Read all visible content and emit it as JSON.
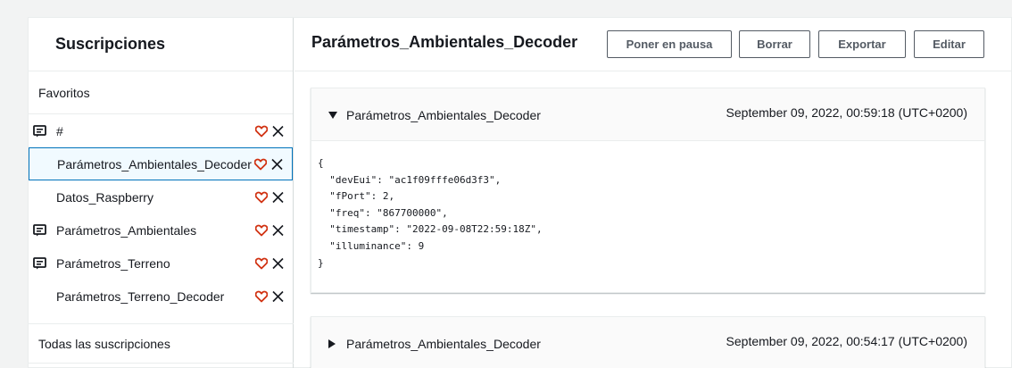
{
  "left_panel": {
    "title": "Suscripciones",
    "favorites_label": "Favoritos",
    "all_label": "Todas las suscripciones",
    "topics": [
      {
        "label": "#",
        "icon": "message-icon",
        "selected": false
      },
      {
        "label": "Parámetros_Ambientales_Decoder",
        "icon": null,
        "selected": true
      },
      {
        "label": "Datos_Raspberry",
        "icon": null,
        "selected": false
      },
      {
        "label": "Parámetros_Ambientales",
        "icon": "message-icon",
        "selected": false
      },
      {
        "label": "Parámetros_Terreno",
        "icon": "message-icon",
        "selected": false
      },
      {
        "label": "Parámetros_Terreno_Decoder",
        "icon": null,
        "selected": false
      }
    ]
  },
  "right_panel": {
    "title": "Parámetros_Ambientales_Decoder",
    "buttons": {
      "pause": "Poner en pausa",
      "delete": "Borrar",
      "export": "Exportar",
      "edit": "Editar"
    },
    "messages": [
      {
        "topic": "Parámetros_Ambientales_Decoder",
        "timestamp": "September 09, 2022, 00:59:18 (UTC+0200)",
        "expanded": true,
        "payload": "{\n  \"devEui\": \"ac1f09fffe06d3f3\",\n  \"fPort\": 2,\n  \"freq\": \"867700000\",\n  \"timestamp\": \"2022-09-08T22:59:18Z\",\n  \"illuminance\": 9\n}"
      },
      {
        "topic": "Parámetros_Ambientales_Decoder",
        "timestamp": "September 09, 2022, 00:54:17 (UTC+0200)",
        "expanded": false
      }
    ]
  },
  "colors": {
    "accent_blue": "#0073bb",
    "favorite_red": "#d13212",
    "icon_dark": "#16191f",
    "button_border": "#545b64"
  }
}
